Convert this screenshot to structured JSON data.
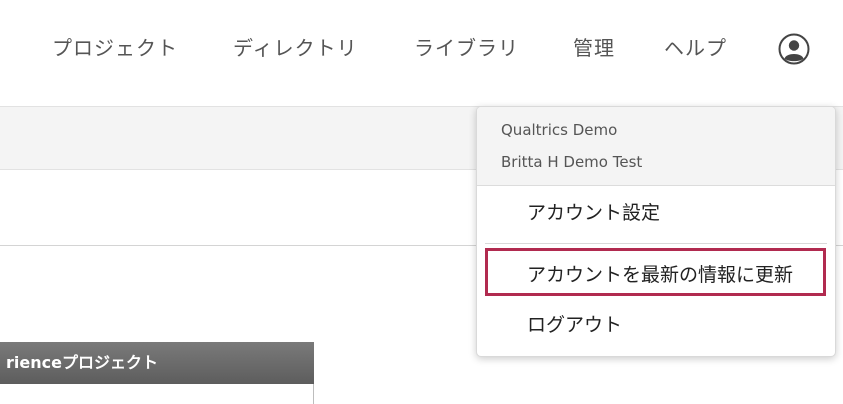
{
  "nav": {
    "items": [
      {
        "label": "プロジェクト"
      },
      {
        "label": "ディレクトリ"
      },
      {
        "label": "ライブラリ"
      },
      {
        "label": "管理"
      },
      {
        "label": "ヘルプ"
      }
    ]
  },
  "project": {
    "header_label": "rienceプロジェクト"
  },
  "account_menu": {
    "organization": "Qualtrics Demo",
    "user": "Britta H Demo Test",
    "items": [
      {
        "label": "アカウント設定"
      },
      {
        "label": "アカウントを最新の情報に更新"
      },
      {
        "label": "ログアウト"
      }
    ]
  },
  "colors": {
    "highlight": "#b12a4f",
    "toolbar_bg": "#f4f4f4",
    "project_header_bg": "#6d6d6d"
  },
  "icons": {
    "avatar": "user-circle-icon"
  }
}
